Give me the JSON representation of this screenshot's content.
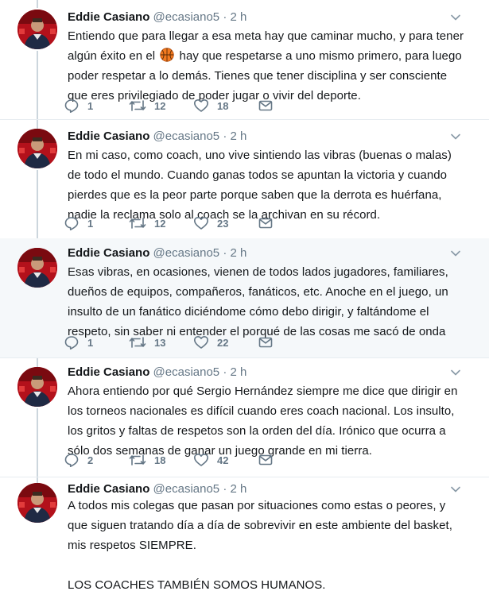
{
  "author": {
    "name": "Eddie Casiano",
    "handle": "@ecasiano5",
    "separator": "·"
  },
  "tweets": [
    {
      "time": "2 h",
      "text_part1": "Entiendo que para llegar a esa meta hay que caminar mucho, y para tener algún éxito en el",
      "emoji": "basketball-emoji",
      "text_part2": "hay que respetarse a uno mismo primero, para luego poder respetar a lo demás. Tienes que tener disciplina y ser consciente que eres privilegiado de poder jugar o vivir del deporte.",
      "replies": "1",
      "retweets": "12",
      "likes": "18"
    },
    {
      "time": "2 h",
      "text": "En mi caso, como coach, uno vive sintiendo las vibras (buenas o malas) de todo el mundo.  Cuando ganas todos se apuntan la victoria y cuando pierdes que es la peor parte porque saben que la derrota es huérfana, nadie la reclama solo al coach se la archivan en su récord.",
      "replies": "1",
      "retweets": "12",
      "likes": "23"
    },
    {
      "time": "2 h",
      "text": "Esas vibras, en ocasiones, vienen de todos lados jugadores, familiares, dueños de equipos, compañeros, fanáticos, etc. Anoche en el juego, un insulto de un fanático diciéndome cómo debo dirigir, y faltándome el respeto, sin saber ni entender el porqué de las cosas me sacó de onda",
      "replies": "1",
      "retweets": "13",
      "likes": "22"
    },
    {
      "time": "2 h",
      "text": "Ahora entiendo por qué Sergio Hernández siempre me dice que dirigir en los torneos nacionales es difícil cuando eres coach nacional. Los insulto, los gritos y faltas de respetos son la orden del día. Irónico que ocurra a sólo dos semanas de ganar un juego grande en mi tierra.",
      "replies": "2",
      "retweets": "18",
      "likes": "42"
    },
    {
      "time": "2 h",
      "text": "A todos mis colegas que pasan por situaciones como estas o peores, y que siguen tratando día a día de sobrevivir en este ambiente del basket, mis respetos SIEMPRE.",
      "text_extra": "LOS COACHES TAMBIÉN SOMOS HUMANOS."
    }
  ],
  "colors": {
    "text": "#14171a",
    "secondary": "#657786",
    "thread_line": "#ccd6dd",
    "highlight_bg": "#f5f8fa",
    "avatar_red": "#b3111b"
  },
  "icons": {
    "reply": "reply-icon",
    "retweet": "retweet-icon",
    "like": "heart-icon",
    "dm": "envelope-icon",
    "more": "chevron-down-icon"
  }
}
